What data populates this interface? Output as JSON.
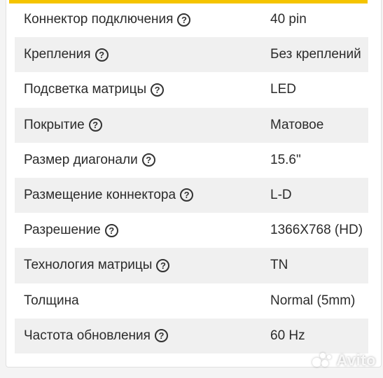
{
  "specs": [
    {
      "label": "Коннектор подключения",
      "help": true,
      "value": "40 pin"
    },
    {
      "label": "Крепления",
      "help": true,
      "value": "Без креплений"
    },
    {
      "label": "Подсветка матрицы",
      "help": true,
      "value": "LED"
    },
    {
      "label": "Покрытие",
      "help": true,
      "value": "Матовое"
    },
    {
      "label": "Размер диагонали",
      "help": true,
      "value": "15.6\""
    },
    {
      "label": "Размещение коннектора",
      "help": true,
      "value": "L-D"
    },
    {
      "label": "Разрешение",
      "help": true,
      "value": "1366X768 (HD)"
    },
    {
      "label": "Технология матрицы",
      "help": true,
      "value": "TN"
    },
    {
      "label": "Толщина",
      "help": false,
      "value": "Normal (5mm)"
    },
    {
      "label": "Частота обновления",
      "help": true,
      "value": "60 Hz"
    }
  ],
  "help_glyph": "?",
  "watermark": "Avito",
  "colors": {
    "accent": "#f5c400",
    "row_shade": "#f0f0f0",
    "text": "#2b2b2b"
  },
  "icons": {
    "help": "question-circle-icon",
    "watermark_logo": "avito-logo-icon"
  }
}
